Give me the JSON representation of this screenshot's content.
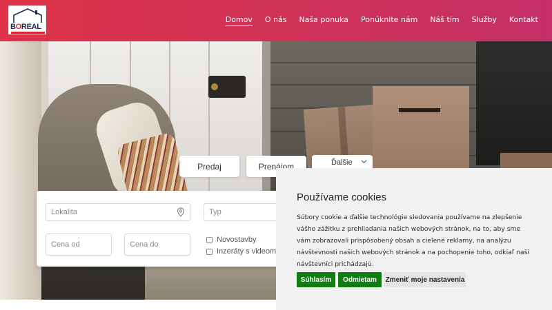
{
  "header": {
    "logo_text_b": "B",
    "logo_text_o": "O",
    "logo_text_rest": "REAL",
    "brand_color": "#de3348",
    "nav": [
      {
        "label": "Domov",
        "active": true
      },
      {
        "label": "O nás",
        "active": false
      },
      {
        "label": "Naša ponuka",
        "active": false
      },
      {
        "label": "Ponúknite nám",
        "active": false
      },
      {
        "label": "Náš tím",
        "active": false
      },
      {
        "label": "Služby",
        "active": false
      },
      {
        "label": "Kontakt",
        "active": false
      }
    ]
  },
  "search": {
    "tabs": [
      "Predaj",
      "Prenájom"
    ],
    "more_label": "Ďalšie",
    "lokalita_placeholder": "Lokalita",
    "typ_placeholder": "Typ",
    "cena_od_placeholder": "Cena od",
    "cena_do_placeholder": "Cena do",
    "checkboxes": [
      {
        "label": "Novostavby",
        "checked": false
      },
      {
        "label": "Inzeráty s videom",
        "checked": false
      }
    ]
  },
  "cookie": {
    "title": "Používame cookies",
    "text": "Súbory cookie a ďalšie technológie sledovania používame na zlepšenie vášho zážitku z prehliadania našich webových stránok, na to, aby sme vám zobrazovali prispôsobený obsah a cielené reklamy, na analýzu návštevnosti našich webových stránok a na pochopenie toho, odkiaľ naši návštevníci prichádzajú.",
    "accept_label": "Súhlasím",
    "reject_label": "Odmietam",
    "settings_label": "Zmeniť moje nastavenia",
    "button_color": "#0f7d12"
  }
}
